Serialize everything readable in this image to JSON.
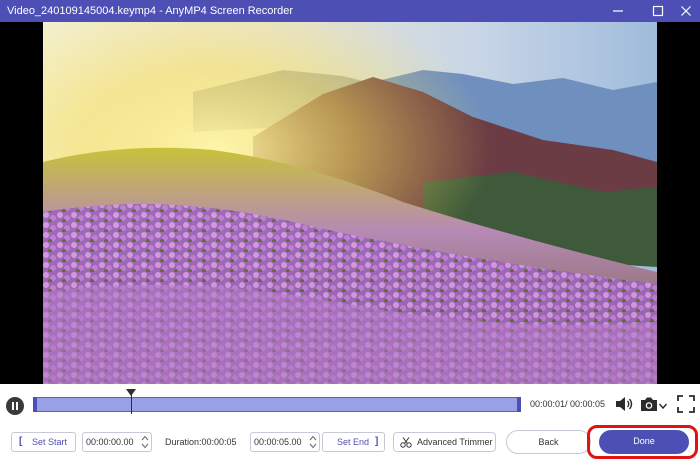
{
  "window": {
    "title": "Video_240109145004.keymp4  -  AnyMP4 Screen Recorder",
    "accent_color": "#4d4fb4",
    "controls": [
      "minimize-icon",
      "maximize-icon",
      "close-icon"
    ]
  },
  "player": {
    "current_time": "00:00:01",
    "total_time": "00:00:05",
    "time_display": "00:00:01/ 00:00:05",
    "playhead_fraction": 0.2,
    "state_icon": "pause-icon",
    "icons": [
      "volume-icon",
      "camera-icon",
      "chevron-down-icon",
      "fullscreen-icon"
    ]
  },
  "trim": {
    "set_start_label": "Set Start",
    "start_bracket": "[",
    "start_value": "00:00:00.00",
    "duration_label": "Duration:00:00:05",
    "end_value": "00:00:05.00",
    "set_end_label": "Set End",
    "end_bracket": "]",
    "advanced_trimmer_label": "Advanced Trimmer"
  },
  "actions": {
    "back_label": "Back",
    "done_label": "Done",
    "highlight_color": "#e01313"
  }
}
